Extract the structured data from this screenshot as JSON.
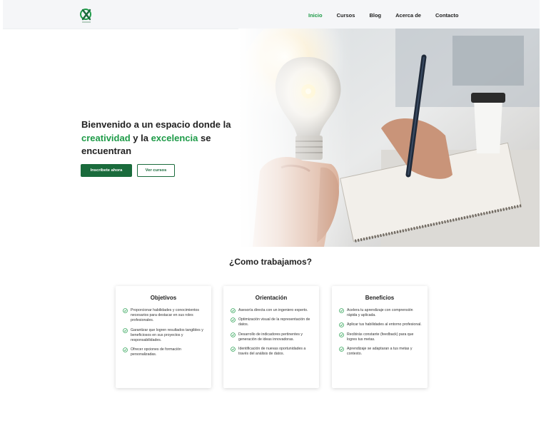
{
  "nav": {
    "items": [
      {
        "label": "Inicio",
        "active": true
      },
      {
        "label": "Cursos",
        "active": false
      },
      {
        "label": "Blog",
        "active": false
      },
      {
        "label": "Acerca de",
        "active": false
      },
      {
        "label": "Contacto",
        "active": false
      }
    ]
  },
  "hero": {
    "title_part1": "Bienvenido a  un espacio donde la ",
    "title_highlight1": "creatividad",
    "title_part2": " y la ",
    "title_highlight2": "excelencia",
    "title_part3": " se encuentran",
    "primary_button": "Inscríbete ahora",
    "secondary_button": "Ver cursos",
    "image": "lightbulb-hand-writing-photo"
  },
  "section": {
    "title": "¿Como trabajamos?"
  },
  "cards": [
    {
      "title": "Objetivos",
      "items": [
        "Proporcionar  habilidades y conocimientos necesarios para destacar en sus roles profesionales.",
        "Garantizar que logren resultados tangibles y beneficiosos en sus proyectos y responsabilidades.",
        "Ofrecer opciones de formación personalizadas."
      ]
    },
    {
      "title": "Orientación",
      "items": [
        "Asesoría directa con un ingeniero experto.",
        "Optimización visual de la representación de datos.",
        "Desarrollo de indicadores pertinentes y generación de ideas innovadoras.",
        "Identificación de nuevas oportunidades a través del análisis de datos."
      ]
    },
    {
      "title": "Beneficios",
      "items": [
        "Acelera tu aprendizaje con comprensión rápida y aplicada.",
        "Aplicar tus habilidades al entorno profesional.",
        "Recibirás constante (feedback) para que logres tus metas.",
        "Aprendizaje se  adaptaran a tus metas y contexto."
      ]
    }
  ],
  "colors": {
    "accent": "#1e9b48",
    "button_dark": "#1a6b3c",
    "nav_bg": "#f5f6f8"
  }
}
